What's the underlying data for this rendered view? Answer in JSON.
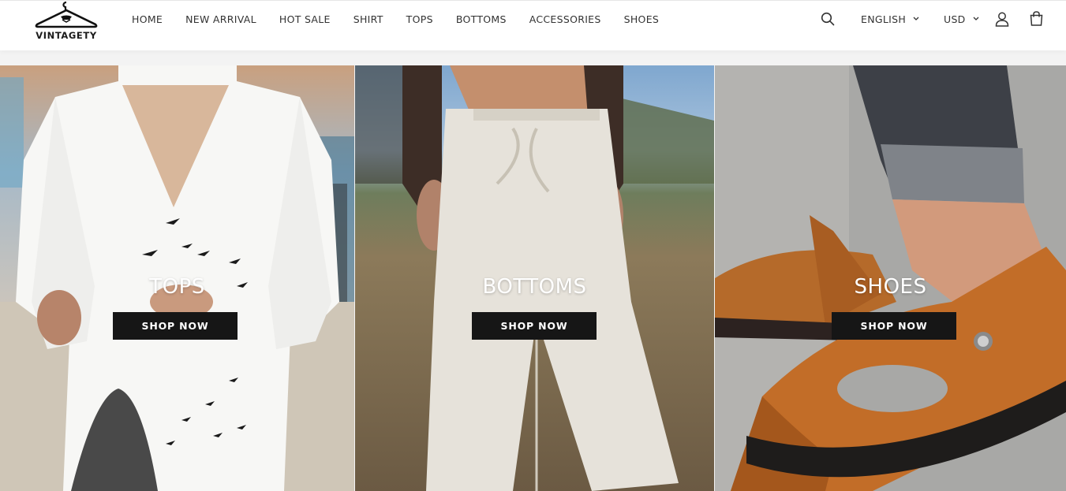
{
  "brand": {
    "name": "VINTAGETY"
  },
  "nav": {
    "items": [
      {
        "label": "HOME"
      },
      {
        "label": "NEW ARRIVAL"
      },
      {
        "label": "HOT SALE"
      },
      {
        "label": "SHIRT"
      },
      {
        "label": "TOPS"
      },
      {
        "label": "BOTTOMS"
      },
      {
        "label": "ACCESSORIES"
      },
      {
        "label": "SHOES"
      }
    ]
  },
  "tools": {
    "language": "ENGLISH",
    "currency": "USD",
    "icons": [
      "search-icon",
      "chevron-down-icon",
      "account-icon",
      "cart-icon"
    ]
  },
  "panels": [
    {
      "title": "TOPS",
      "button": "SHOP NOW"
    },
    {
      "title": "BOTTOMS",
      "button": "SHOP NOW"
    },
    {
      "title": "SHOES",
      "button": "SHOP NOW"
    }
  ],
  "colors": {
    "button_bg": "#161616",
    "header_bg": "#ffffff",
    "text": "#333333"
  }
}
